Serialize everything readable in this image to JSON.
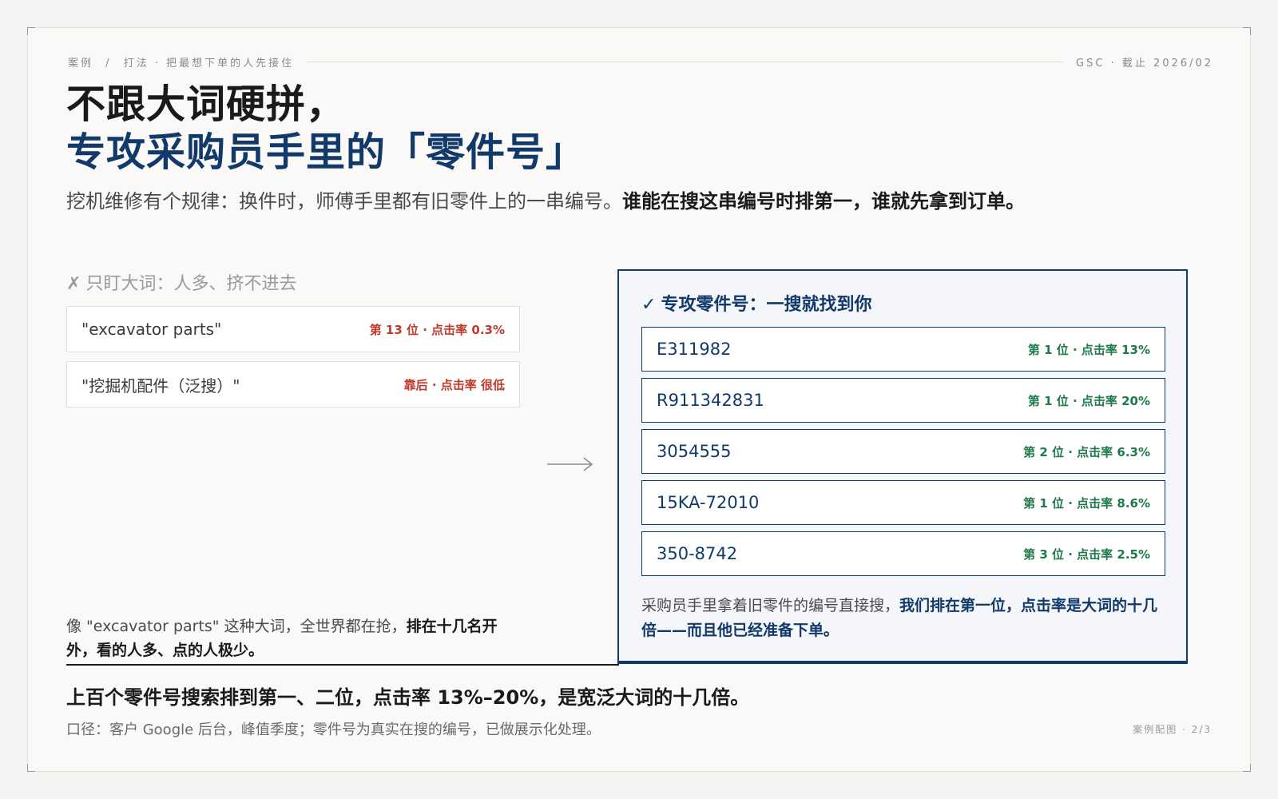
{
  "topbar": {
    "crumbs": [
      "案例",
      "打法 · 把最想下单的人先接住"
    ],
    "separator": "/",
    "right": "GSC · 截止 2026/02"
  },
  "headline": {
    "line1": "不跟大词硬拼，",
    "line2": "专攻采购员手里的「零件号」"
  },
  "lede": {
    "plain": "挖机维修有个规律：换件时，师傅手里都有旧零件上的一串编号。",
    "bold": "谁能在搜这串编号时排第一，谁就先拿到订单。"
  },
  "left": {
    "mark": "✗",
    "title": "只盯大词：人多、挤不进去",
    "rows": [
      {
        "keyword": "\"excavator parts\"",
        "meta": "第 13 位 · 点击率 0.3%"
      },
      {
        "keyword": "\"挖掘机配件（泛搜）\"",
        "meta": "靠后 · 点击率 很低"
      }
    ],
    "foot_plain": "像 \"excavator parts\" 这种大词，全世界都在抢，",
    "foot_bold": "排在十几名开外，看的人多、点的人极少。"
  },
  "right": {
    "mark": "✓",
    "title": "专攻零件号：一搜就找到你",
    "rows": [
      {
        "keyword": "E311982",
        "meta": "第 1 位 · 点击率 13%"
      },
      {
        "keyword": "R911342831",
        "meta": "第 1 位 · 点击率 20%"
      },
      {
        "keyword": "3054555",
        "meta": "第 2 位 · 点击率 6.3%"
      },
      {
        "keyword": "15KA-72010",
        "meta": "第 1 位 · 点击率 8.6%"
      },
      {
        "keyword": "350-8742",
        "meta": "第 3 位 · 点击率 2.5%"
      }
    ],
    "foot_plain": "采购员手里拿着旧零件的编号直接搜，",
    "foot_bold": "我们排在第一位，点击率是大词的十几倍——而且他已经准备下单。"
  },
  "conclusion": "上百个零件号搜索排到第一、二位，点击率 13%–20%，是宽泛大词的十几倍。",
  "source": "口径：客户 Google 后台，峰值季度；零件号为真实在搜的编号，已做展示化处理。",
  "pager": "案例配图 · 2/3",
  "colors": {
    "navy": "#113a6b",
    "red": "#c0392b",
    "green": "#1e7a4a"
  }
}
